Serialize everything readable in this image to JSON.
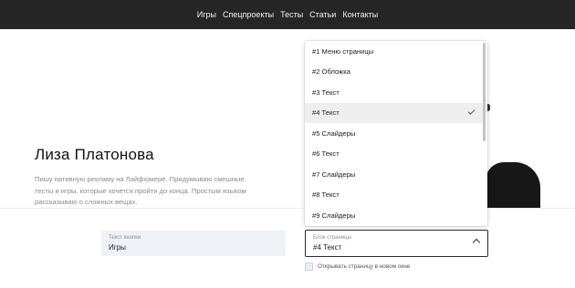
{
  "nav": {
    "links": [
      "Игры",
      "Спецпроекты",
      "Тесты",
      "Статьи",
      "Контакты"
    ]
  },
  "hero": {
    "name": "Лиза Платонова",
    "description": "Пишу нативную рекламу на Лайфхакере. Придумываю смешные тесты и игры, которые хочется пройти до конца. Простым языком рассказываю о сложных вещах."
  },
  "form": {
    "button_text": {
      "label": "Текст кнопки",
      "value": "Игры"
    },
    "page_block": {
      "label": "Блок страницы",
      "value": "#4 Текст",
      "selected_index": 3,
      "options": [
        "#1 Меню страницы",
        "#2 Обложка",
        "#3 Текст",
        "#4 Текст",
        "#5 Слайдеры",
        "#6 Текст",
        "#7 Слайдеры",
        "#8 Текст",
        "#9 Слайдеры"
      ]
    },
    "new_window": {
      "label": "Открывать страницу в новом окне",
      "checked": false
    }
  },
  "icons": {
    "chevron": "chevron-up-icon",
    "check": "check-icon"
  },
  "colors": {
    "nav_bg": "#262626",
    "field_bg": "#eef1f6",
    "selected_bg": "#eeeeee"
  }
}
